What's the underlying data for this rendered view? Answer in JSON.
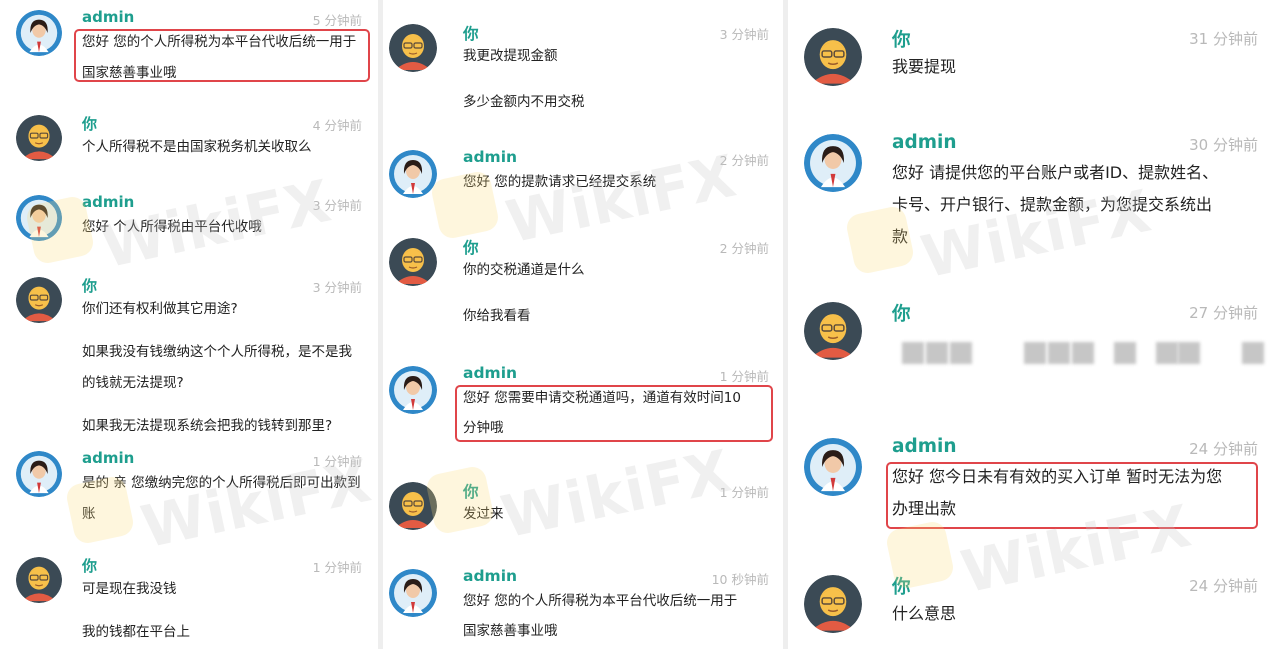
{
  "watermark": "WikiFX",
  "colors": {
    "name": "#1e9e8e",
    "time": "#b9b9b9",
    "highlight": "#e0454a"
  },
  "col1": [
    {
      "sender": "admin",
      "time": "5 分钟前",
      "lines": [
        "您好 您的个人所得税为本平台代收后统一用于",
        "国家慈善事业哦"
      ]
    },
    {
      "sender": "你",
      "time": "4 分钟前",
      "lines": [
        "个人所得税不是由国家税务机关收取么"
      ]
    },
    {
      "sender": "admin",
      "time": "3 分钟前",
      "lines": [
        "您好 个人所得税由平台代收哦"
      ]
    },
    {
      "sender": "你",
      "time": "3 分钟前",
      "lines": [
        "你们还有权利做其它用途?",
        "如果我没有钱缴纳这个个人所得税，是不是我",
        "的钱就无法提现?",
        "如果我无法提现系统会把我的钱转到那里?"
      ]
    },
    {
      "sender": "admin",
      "time": "1 分钟前",
      "lines": [
        "是的 亲 您缴纳完您的个人所得税后即可出款到",
        "账"
      ]
    },
    {
      "sender": "你",
      "time": "1 分钟前",
      "lines": [
        "可是现在我没钱",
        "我的钱都在平台上"
      ]
    }
  ],
  "col2": [
    {
      "sender": "你",
      "time": "3 分钟前",
      "lines": [
        "我更改提现金额",
        "多少金额内不用交税"
      ]
    },
    {
      "sender": "admin",
      "time": "2 分钟前",
      "lines": [
        "您好 您的提款请求已经提交系统"
      ]
    },
    {
      "sender": "你",
      "time": "2 分钟前",
      "lines": [
        "你的交税通道是什么",
        "你给我看看"
      ]
    },
    {
      "sender": "admin",
      "time": "1 分钟前",
      "lines": [
        "您好 您需要申请交税通道吗，通道有效时间10",
        "分钟哦"
      ]
    },
    {
      "sender": "你",
      "time": "1 分钟前",
      "lines": [
        "发过来"
      ]
    },
    {
      "sender": "admin",
      "time": "10 秒钟前",
      "lines": [
        "您好 您的个人所得税为本平台代收后统一用于",
        "国家慈善事业哦"
      ]
    }
  ],
  "col3": [
    {
      "sender": "你",
      "time": "31 分钟前",
      "lines": [
        "我要提现"
      ]
    },
    {
      "sender": "admin",
      "time": "30 分钟前",
      "lines": [
        "您好 请提供您的平台账户或者ID、提款姓名、",
        "卡号、开户银行、提款金额，为您提交系统出",
        "款"
      ]
    },
    {
      "sender": "你",
      "time": "27 分钟前",
      "lines": []
    },
    {
      "sender": "admin",
      "time": "24 分钟前",
      "lines": [
        "您好 您今日未有有效的买入订单 暂时无法为您",
        "办理出款"
      ]
    },
    {
      "sender": "你",
      "time": "24 分钟前",
      "lines": [
        "什么意思"
      ]
    }
  ]
}
